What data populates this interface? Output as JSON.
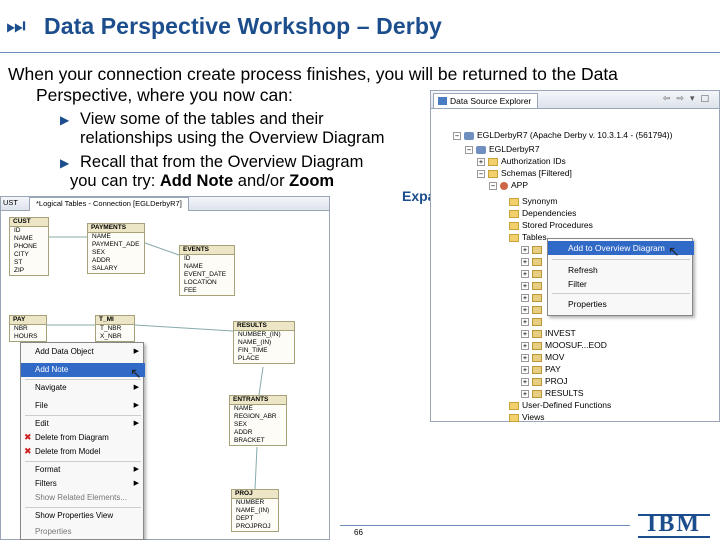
{
  "title": {
    "icon": "media-skip-forward-icon",
    "text": "Data Perspective Workshop – Derby"
  },
  "intro": {
    "line1": "When your connection create process finishes, you will be returned to the Data",
    "line2": "Perspective, where you now can:"
  },
  "bullets": [
    {
      "line1": "View some of the tables and their",
      "line2": "relationships using the Overview Diagram"
    },
    {
      "line1": "Recall that from the Overview Diagram",
      "line2_prefix": "you can try: ",
      "bold1": "Add Note",
      "mid": " and/or ",
      "bold2": "Zoom"
    }
  ],
  "expand_label": "Expand",
  "explorer": {
    "tab": "Data Source Explorer",
    "tree": [
      "EGLDerbyR7 (Apache Derby v. 10.3.1.4 - (561794))",
      "EGLDerbyR7",
      "Authorization IDs",
      "Schemas [Filtered]",
      "APP",
      "Synonym",
      "Dependencies",
      "Stored Procedures",
      "Tables",
      "INVEST",
      "MOOSUF...EOD",
      "MOV",
      "PAY",
      "PROJ",
      "RESULTS",
      "User-Defined Functions",
      "Views"
    ],
    "context_menu": [
      "Add to Overview Diagram",
      "Refresh",
      "Filter",
      "Properties"
    ]
  },
  "diagram": {
    "tab1": "UST",
    "tab2": "*Logical Tables - Connection [EGLDerbyR7]",
    "entities": [
      {
        "name": "CUST",
        "cols": [
          "ID",
          "NAME",
          "PHONE",
          "CITY",
          "ST",
          "ZIP"
        ]
      },
      {
        "name": "PAYMENTS",
        "cols": [
          "NAME",
          "PAYMENT_ADE",
          "SEX",
          "ADDR",
          "SALARY"
        ]
      },
      {
        "name": "EVENTS",
        "cols": [
          "ID",
          "NAME",
          "EVENT_DATE",
          "LOCATION",
          "FEE"
        ]
      },
      {
        "name": "PAY",
        "cols": [
          "NBR",
          "HOURS"
        ]
      },
      {
        "name": "T_MI",
        "cols": [
          "T_NBR",
          "X_NBR"
        ]
      },
      {
        "name": "RESULTS",
        "cols": [
          "NUMBER_(IN)",
          "NAME_(IN)",
          "FIN_TIME",
          "PLACE"
        ]
      },
      {
        "name": "ENTRANTS",
        "cols": [
          "NAME",
          "REGION_ABR",
          "SEX",
          "ADDR",
          "BRACKET"
        ]
      },
      {
        "name": "PROJ",
        "cols": [
          "NUMBER",
          "NAME_(IN)",
          "DEPT",
          "PROJPROJ"
        ]
      }
    ],
    "context_menu": [
      "Add Data Object",
      "Add Note",
      "Navigate",
      "File",
      "Edit",
      "Delete from Diagram",
      "Delete from Model",
      "Format",
      "Filters",
      "Show Related Elements...",
      "Show Properties View",
      "Properties"
    ]
  },
  "footer": {
    "page_number": "66",
    "logo": "IBM"
  }
}
